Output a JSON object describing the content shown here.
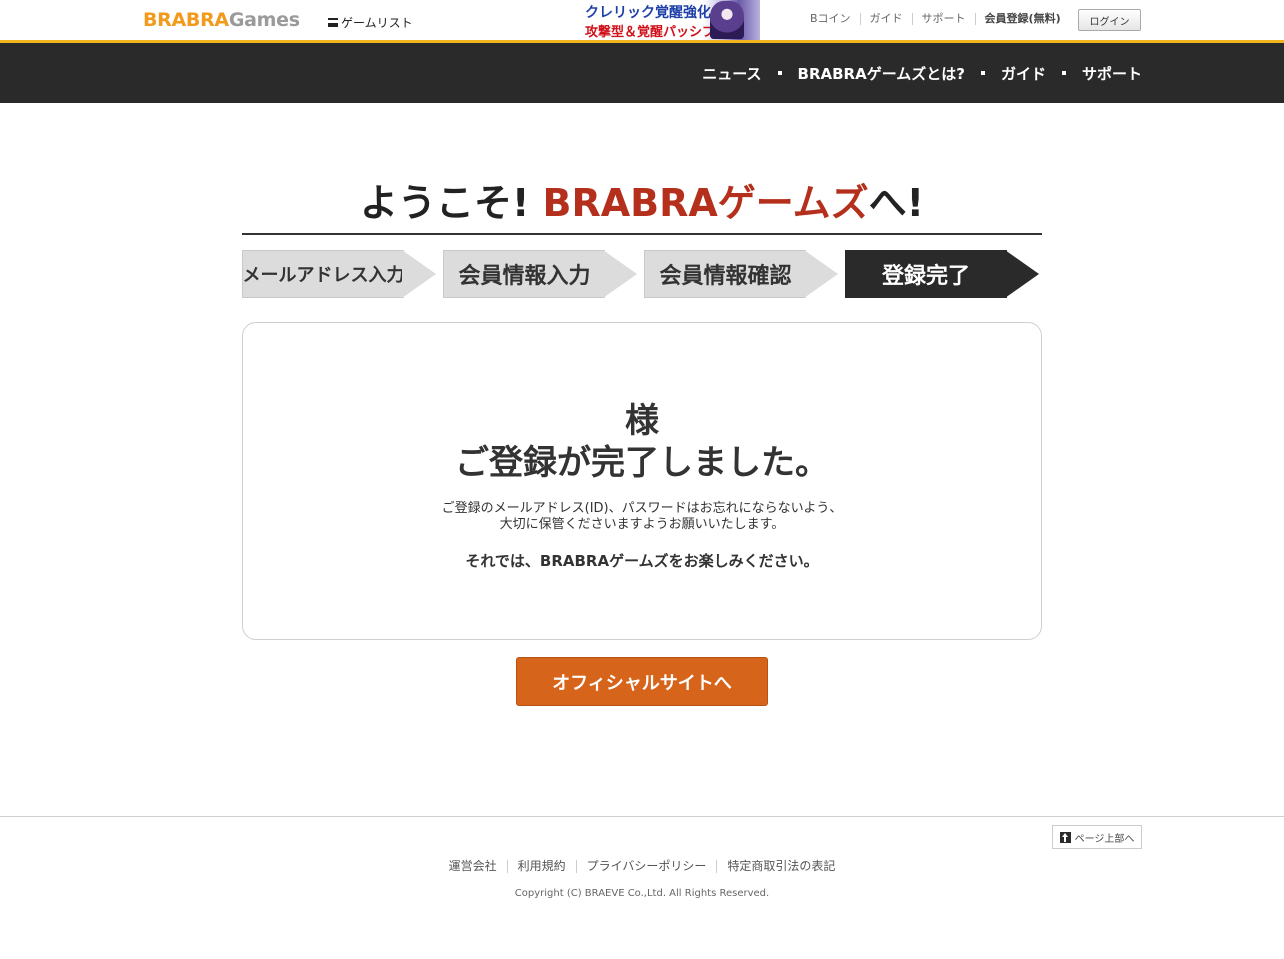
{
  "header": {
    "logo_primary": "BRABRA",
    "logo_secondary": "Games",
    "game_list": "ゲームリスト",
    "banner_line1": "クレリック覚醒強化!",
    "banner_line2": "攻撃型＆覚醒パッシブ",
    "links": [
      "Bコイン",
      "ガイド",
      "サポート",
      "会員登録(無料)"
    ],
    "login": "ログイン"
  },
  "nav": {
    "items": [
      "ニュース",
      "BRABRAゲームズとは?",
      "ガイド",
      "サポート"
    ]
  },
  "welcome": {
    "prefix": "ようこそ! ",
    "brand": "BRABRAゲームズ",
    "suffix": "へ!"
  },
  "steps": [
    {
      "label": "メールアドレス入力",
      "state": "done"
    },
    {
      "label": "会員情報入力",
      "state": "done"
    },
    {
      "label": "会員情報確認",
      "state": "done"
    },
    {
      "label": "登録完了",
      "state": "current"
    }
  ],
  "card": {
    "honorific": "様",
    "done_message": "ご登録が完了しました。",
    "note_line1": "ご登録のメールアドレス(ID)、パスワードはお忘れにならないよう、",
    "note_line2": "大切に保管くださいますようお願いいたします。",
    "enjoy": "それでは、BRABRAゲームズをお楽しみください。"
  },
  "official_button": "オフィシャルサイトへ",
  "footer": {
    "page_top": "ページ上部へ",
    "links": [
      "運営会社",
      "利用規約",
      "プライバシーポリシー",
      "特定商取引法の表記"
    ],
    "copyright": "Copyright (C) BRAEVE Co.,Ltd. All Rights Reserved."
  },
  "colors": {
    "accent_yellow": "#f2b41c",
    "brand_red": "#b5301c",
    "button_orange": "#d6651b",
    "nav_dark": "#2a2a2a"
  }
}
